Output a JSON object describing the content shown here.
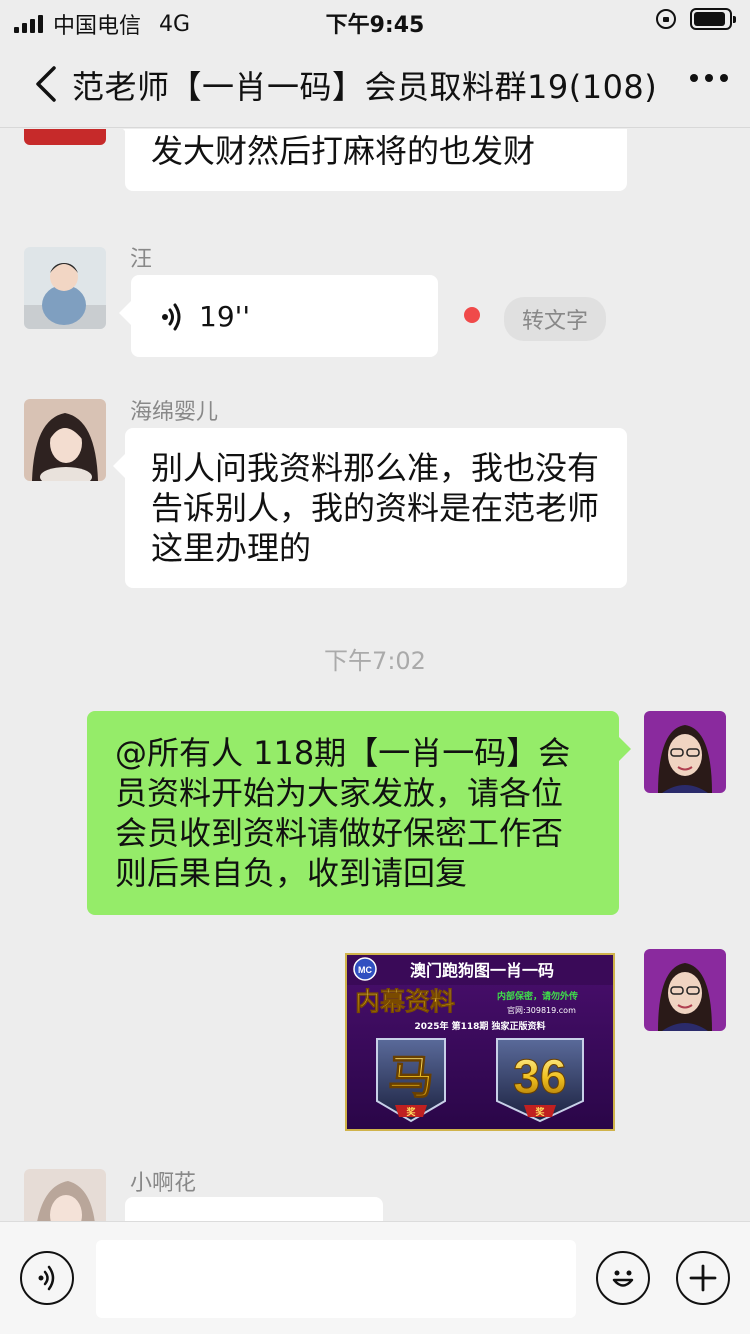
{
  "status_bar": {
    "carrier": "中国电信",
    "network": "4G",
    "time": "下午9:45",
    "battery_level": 0.9
  },
  "nav": {
    "title": "范老师【一肖一码】会员取料群19(108)",
    "back_icon": "chevron-left-icon",
    "more_icon": "more-horizontal-icon"
  },
  "messages": {
    "top_partial": {
      "text": "祝我们大家跟着范老师这份资料发大财然后打麻将的也发财"
    },
    "voice": {
      "sender": "汪",
      "duration": "19''",
      "convert_label": "转文字"
    },
    "text1": {
      "sender": "海绵婴儿",
      "text": "别人问我资料那么准，我也没有告诉别人，我的资料是在范老师这里办理的"
    },
    "divider_time": "下午7:02",
    "own_text": {
      "text": "@所有人 118期【一肖一码】会员资料开始为大家发放，请各位会员收到资料请做好保密工作否则后果自负，收到请回复"
    },
    "own_image": {
      "logo": "MC",
      "headline": "澳门跑狗图一肖一码",
      "sub_headline": "内幕资料",
      "side_note": "内部保密，请勿外传",
      "website": "官网:309819.com",
      "issue_line": "2025年 第118期 独家正版资料",
      "zodiac": "马",
      "number": "36",
      "ribbon_label": "奖"
    },
    "last": {
      "sender": "小啊花"
    }
  },
  "input_bar": {
    "voice_icon": "voice-input-icon",
    "emoji_icon": "emoji-icon",
    "plus_icon": "plus-icon"
  },
  "colors": {
    "background": "#ededed",
    "own_bubble": "#95ec69",
    "other_bubble": "#ffffff",
    "unread_dot": "#f04a4a"
  }
}
